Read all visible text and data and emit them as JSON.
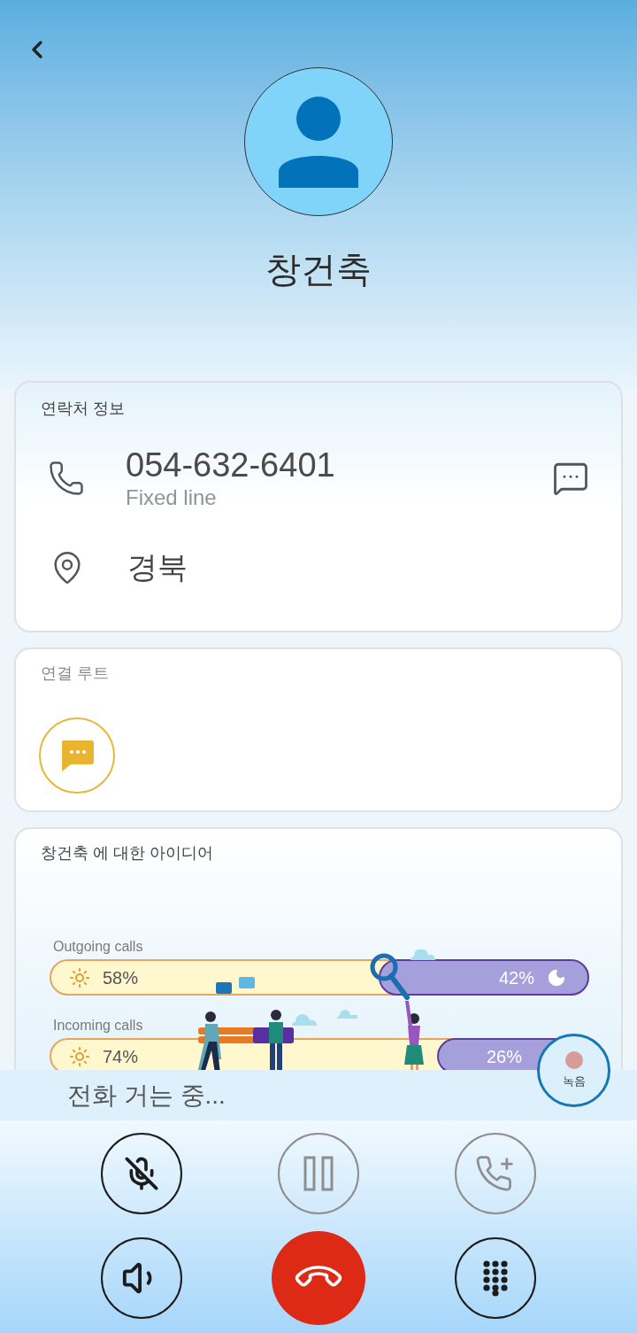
{
  "header": {
    "name": "창건축"
  },
  "contact_info": {
    "title": "연락처 정보",
    "phone": "054-632-6401",
    "phone_type": "Fixed line",
    "location": "경북"
  },
  "connection_route": {
    "title": "연결 루트"
  },
  "insights": {
    "title": "창건축 에 대한 아이디어",
    "stats": [
      {
        "label": "Outgoing calls",
        "day_share": "58%",
        "night_share": "42%"
      },
      {
        "label": "Incoming calls",
        "day_share": "74%",
        "night_share": "26%"
      }
    ]
  },
  "call_status": {
    "text": "전화 거는 중...",
    "record_label": "녹음"
  },
  "controls": [
    {
      "kind": "mute",
      "disabled": false
    },
    {
      "kind": "hold",
      "disabled": true
    },
    {
      "kind": "add_call",
      "disabled": true
    },
    {
      "kind": "speaker",
      "disabled": false
    },
    {
      "kind": "end_call",
      "disabled": false
    },
    {
      "kind": "keypad",
      "disabled": false
    }
  ]
}
